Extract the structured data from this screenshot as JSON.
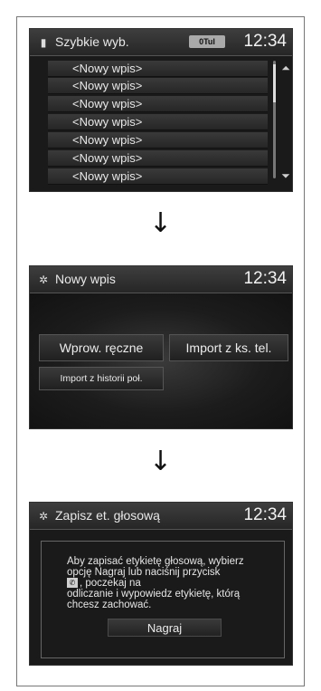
{
  "screens": [
    {
      "icon": "phone-icon",
      "title": "Szybkie wyb.",
      "status": "0Tul",
      "clock": "12:34",
      "items": [
        "<Nowy wpis>",
        "<Nowy wpis>",
        "<Nowy wpis>",
        "<Nowy wpis>",
        "<Nowy wpis>",
        "<Nowy wpis>",
        "<Nowy wpis>"
      ]
    },
    {
      "icon": "gear-icon",
      "title": "Nowy wpis",
      "clock": "12:34",
      "buttons": {
        "manual": "Wprow. ręczne",
        "import_phonebook": "Import z ks. tel.",
        "import_history": "Import z historii poł."
      }
    },
    {
      "icon": "gear-icon",
      "title": "Zapisz et. głosową",
      "clock": "12:34",
      "text_lines": [
        "Aby zapisać etykietę głosową, wybierz",
        "opcję Nagraj lub naciśnij przycisk",
        ", poczekaj na",
        "odliczanie i wypowiedz etykietę, którą",
        "chcesz zachować."
      ],
      "record_button": "Nagraj"
    }
  ],
  "arrows": [
    "↓",
    "↓"
  ],
  "glyphs": {
    "up": "⌃",
    "down": "⌄",
    "phone": "▮",
    "gear": "✲",
    "mic": "🎤︎"
  }
}
